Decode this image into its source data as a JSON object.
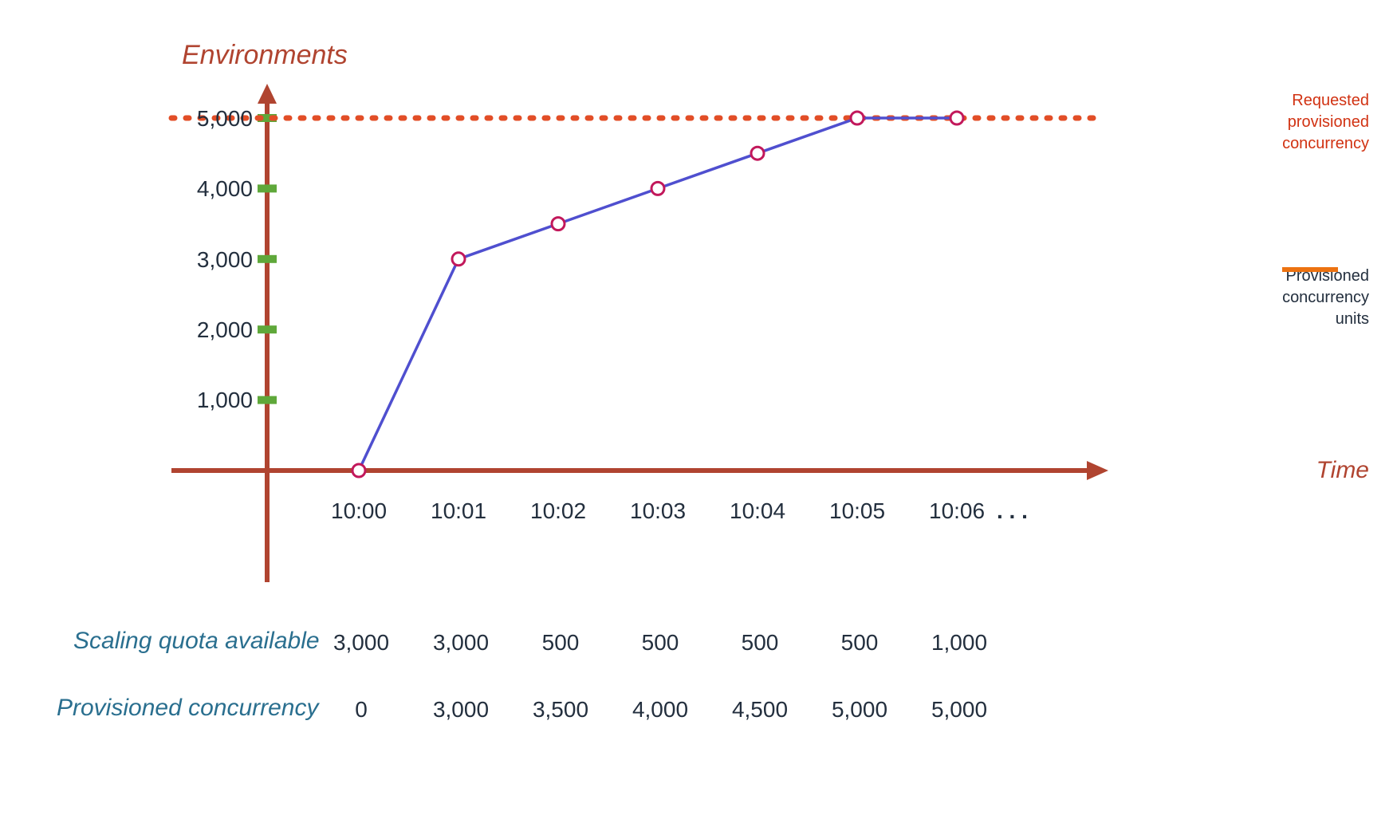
{
  "chart_data": {
    "type": "line",
    "title": "Environments",
    "xlabel": "Time",
    "ylabel": "Environments",
    "ylim": [
      0,
      5000
    ],
    "y_ticks": [
      "1,000",
      "2,000",
      "3,000",
      "4,000",
      "5,000"
    ],
    "x_ticks": [
      "10:00",
      "10:01",
      "10:02",
      "10:03",
      "10:04",
      "10:05",
      "10:06"
    ],
    "x_ellipsis": ". . .",
    "series": [
      {
        "name": "Provisioned concurrency units",
        "x": [
          "10:00",
          "10:01",
          "10:02",
          "10:03",
          "10:04",
          "10:05",
          "10:06"
        ],
        "values": [
          0,
          3000,
          3500,
          4000,
          4500,
          5000,
          5000
        ]
      }
    ],
    "requested_line": {
      "name": "Requested provisioned concurrency",
      "value": 5000
    },
    "table": {
      "rows": [
        {
          "label": "Scaling quota available",
          "values": [
            "3,000",
            "3,000",
            "500",
            "500",
            "500",
            "500",
            "1,000"
          ]
        },
        {
          "label": "Provisioned concurrency",
          "values": [
            "0",
            "3,000",
            "3,500",
            "4,000",
            "4,500",
            "5,000",
            "5,000"
          ]
        }
      ]
    },
    "legend": {
      "requested": "Requested provisioned concurrency",
      "provisioned": "Provisioned concurrency units"
    }
  },
  "colors": {
    "axis": "#b04430",
    "line": "#4f4fcf",
    "marker_stroke": "#c2185b",
    "dotted": "#e24e27",
    "tick_green": "#5fa83a",
    "orange": "#ec7211",
    "teal": "#2a6f8f"
  }
}
